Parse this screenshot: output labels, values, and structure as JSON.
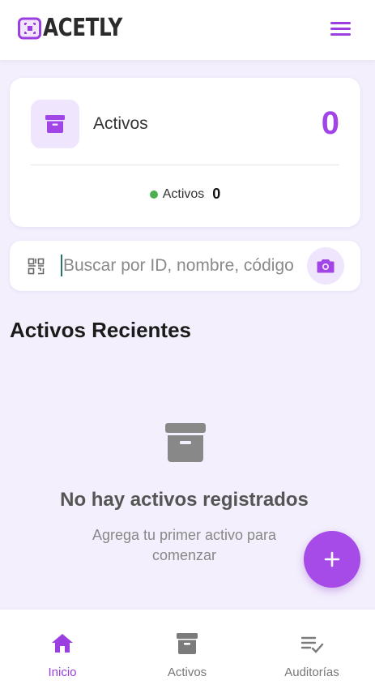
{
  "header": {
    "logo_text": "ACETLY",
    "menu_icon": "hamburger-menu-icon",
    "accent_color": "#9b3fe0"
  },
  "summary_card": {
    "icon": "archive-box-icon",
    "title": "Activos",
    "count": "0",
    "legend": {
      "label": "Activos",
      "value": "0",
      "dot_color": "#4caf50"
    }
  },
  "search": {
    "placeholder": "Buscar por ID, nombre, código",
    "value": "",
    "qr_icon": "qr-code-icon",
    "camera_icon": "camera-icon"
  },
  "recent": {
    "title": "Activos Recientes",
    "empty_title": "No hay activos registrados",
    "empty_subtitle": "Agrega tu primer activo para comenzar"
  },
  "fab": {
    "icon": "plus-icon"
  },
  "bottom_nav": {
    "items": [
      {
        "label": "Inicio",
        "icon": "home-icon",
        "active": true
      },
      {
        "label": "Activos",
        "icon": "archive-box-icon",
        "active": false
      },
      {
        "label": "Auditorías",
        "icon": "checklist-icon",
        "active": false
      }
    ]
  }
}
